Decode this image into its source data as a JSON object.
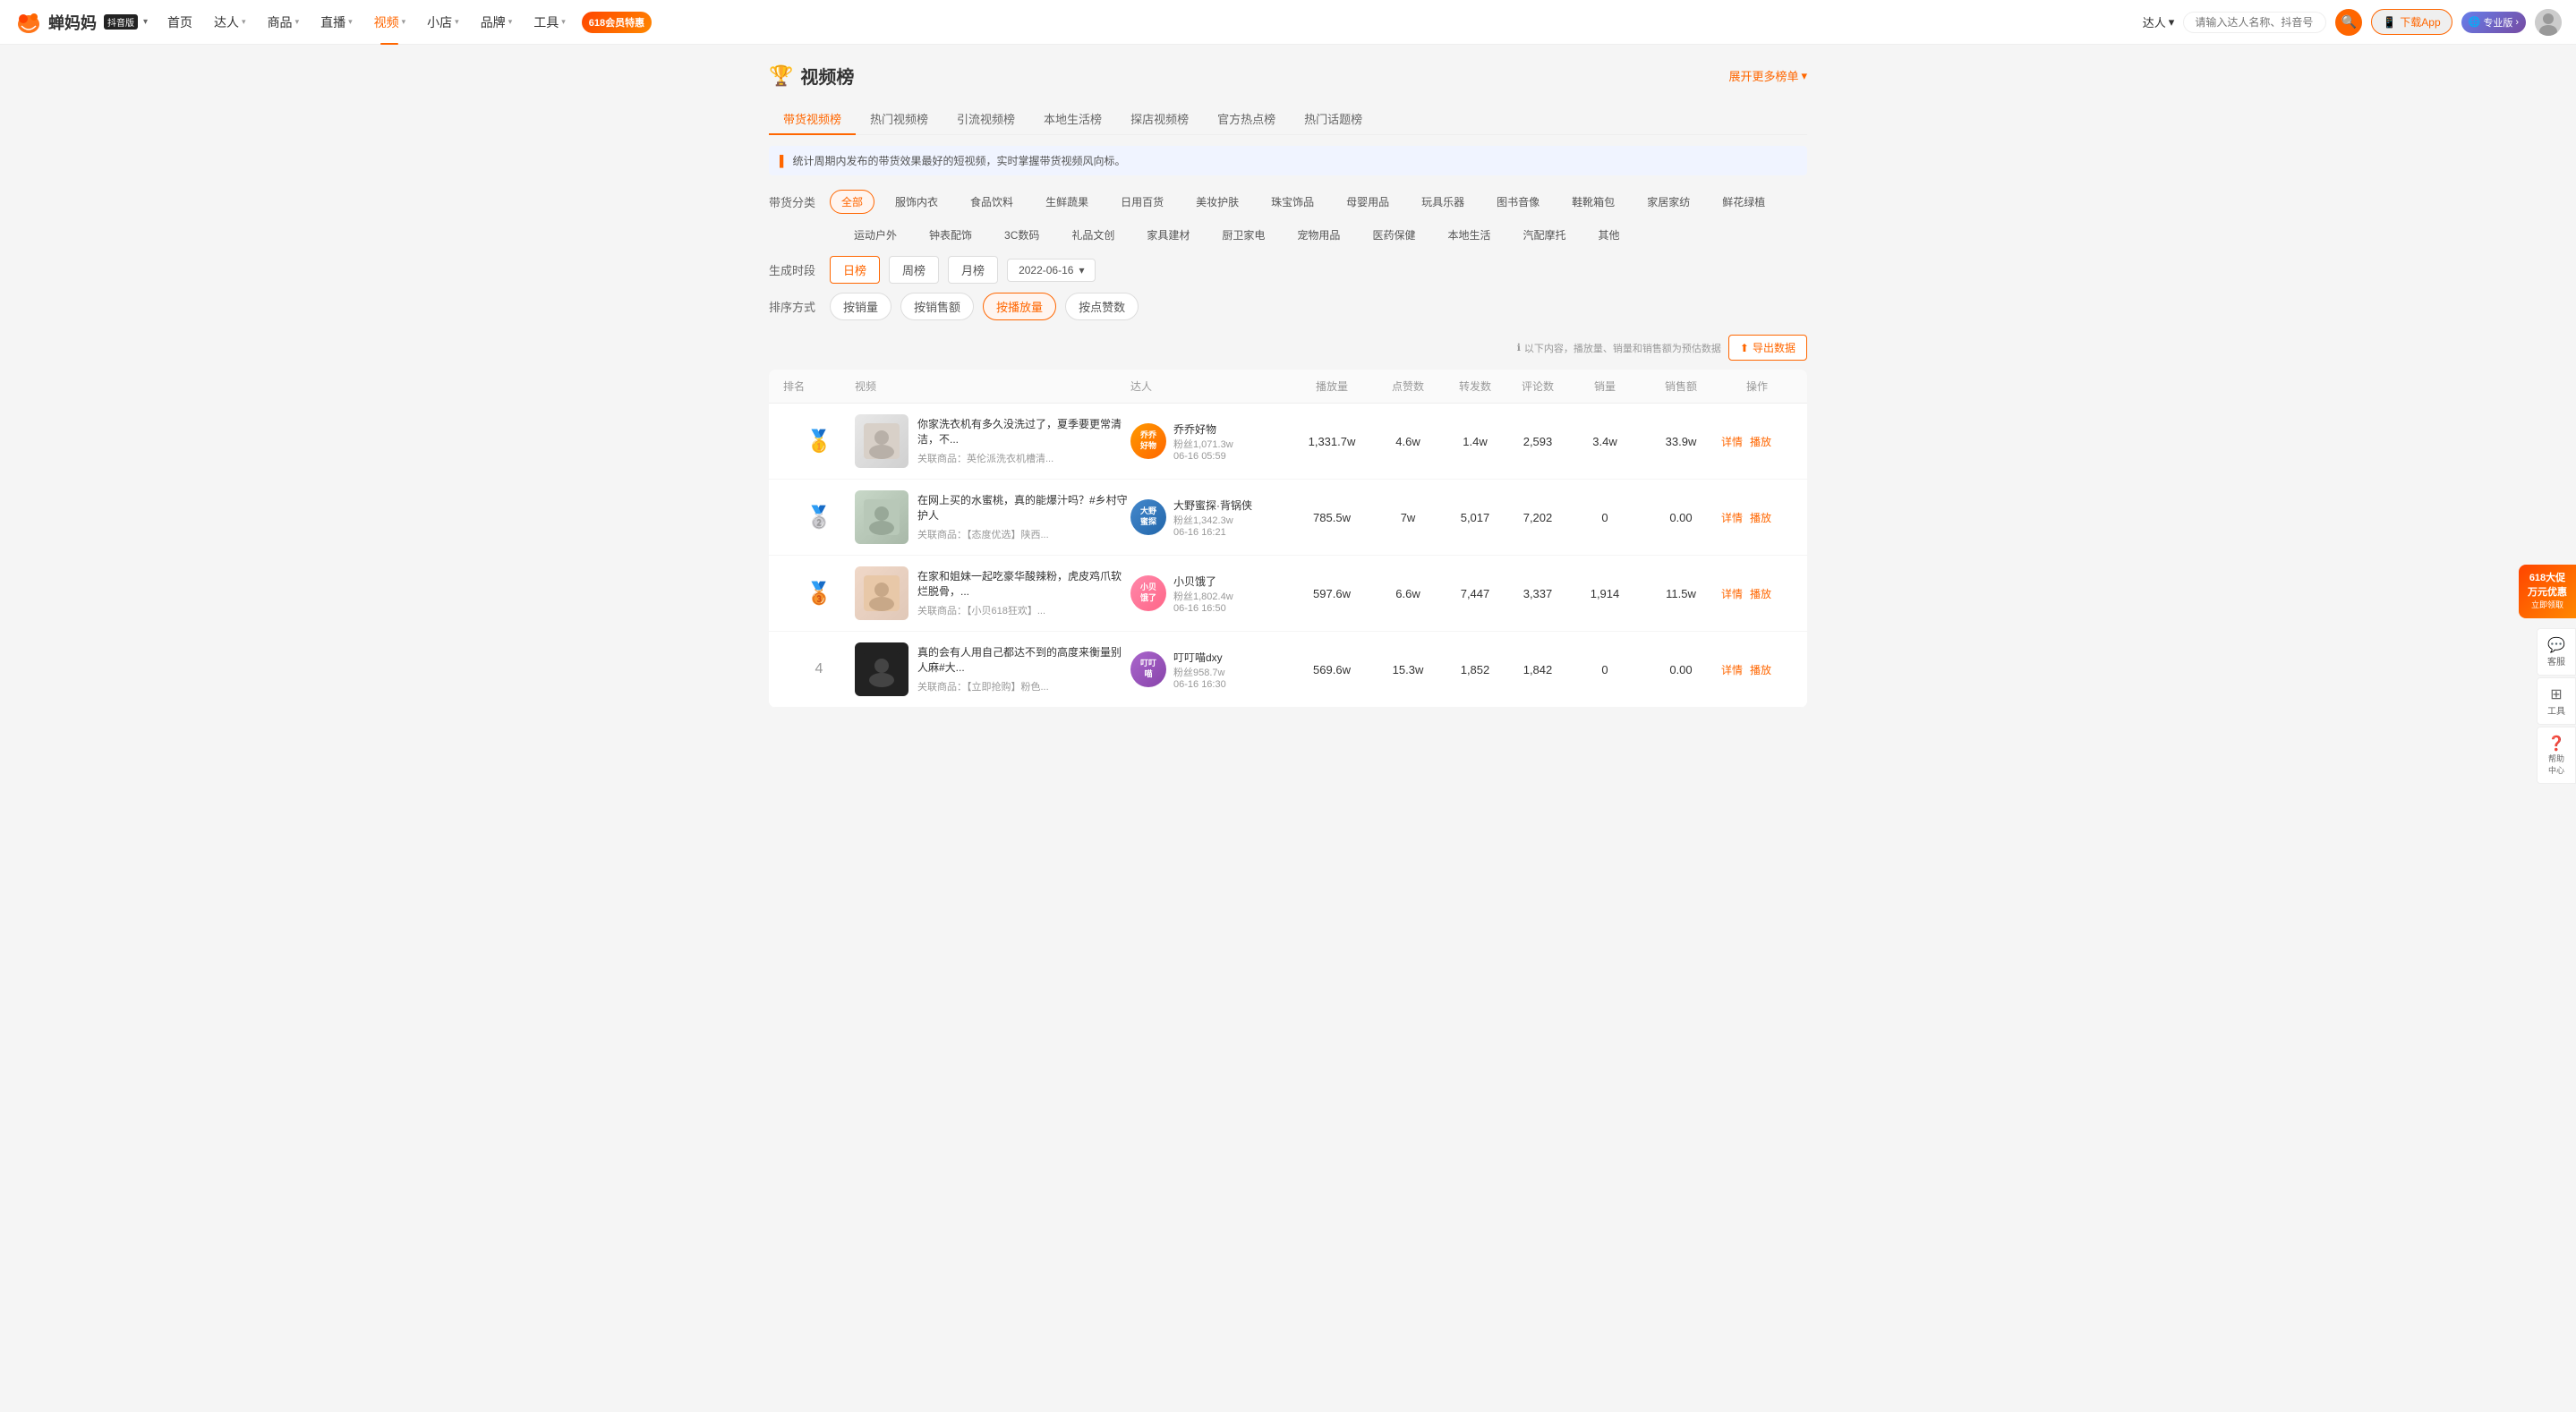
{
  "logo": {
    "text": "蝉妈妈",
    "badge": "抖音版"
  },
  "nav": {
    "chevron": "▾",
    "items": [
      {
        "label": "首页",
        "hasDropdown": false
      },
      {
        "label": "达人",
        "hasDropdown": true
      },
      {
        "label": "商品",
        "hasDropdown": true
      },
      {
        "label": "直播",
        "hasDropdown": true
      },
      {
        "label": "视频",
        "hasDropdown": true,
        "active": true
      },
      {
        "label": "小店",
        "hasDropdown": true
      },
      {
        "label": "品牌",
        "hasDropdown": true
      },
      {
        "label": "工具",
        "hasDropdown": true
      }
    ],
    "promo618": "618\n会员特惠",
    "right": {
      "talent_label": "达人",
      "search_placeholder": "请输入达人名称、抖音号",
      "search_icon": "🔍",
      "download_label": "下载App",
      "pro_label": "专业版",
      "pro_icon": "🌐"
    }
  },
  "page": {
    "title": "视频榜",
    "trophy_icon": "🏆",
    "expand_label": "展开更多榜单",
    "expand_icon": "▾"
  },
  "tabs": [
    {
      "label": "带货视频榜",
      "active": true
    },
    {
      "label": "热门视频榜",
      "active": false
    },
    {
      "label": "引流视频榜",
      "active": false
    },
    {
      "label": "本地生活榜",
      "active": false
    },
    {
      "label": "探店视频榜",
      "active": false
    },
    {
      "label": "官方热点榜",
      "active": false
    },
    {
      "label": "热门话题榜",
      "active": false
    }
  ],
  "info_bar": "统计周期内发布的带货效果最好的短视频，实时掌握带货视频风向标。",
  "filters": {
    "label": "带货分类",
    "row1": [
      {
        "label": "全部",
        "active": true
      },
      {
        "label": "服饰内衣",
        "active": false
      },
      {
        "label": "食品饮料",
        "active": false
      },
      {
        "label": "生鲜蔬果",
        "active": false
      },
      {
        "label": "日用百货",
        "active": false
      },
      {
        "label": "美妆护肤",
        "active": false
      },
      {
        "label": "珠宝饰品",
        "active": false
      },
      {
        "label": "母婴用品",
        "active": false
      },
      {
        "label": "玩具乐器",
        "active": false
      },
      {
        "label": "图书音像",
        "active": false
      },
      {
        "label": "鞋靴箱包",
        "active": false
      },
      {
        "label": "家居家纺",
        "active": false
      },
      {
        "label": "鲜花绿植",
        "active": false
      }
    ],
    "row2": [
      {
        "label": "运动户外",
        "active": false
      },
      {
        "label": "钟表配饰",
        "active": false
      },
      {
        "label": "3C数码",
        "active": false
      },
      {
        "label": "礼品文创",
        "active": false
      },
      {
        "label": "家具建材",
        "active": false
      },
      {
        "label": "厨卫家电",
        "active": false
      },
      {
        "label": "宠物用品",
        "active": false
      },
      {
        "label": "医药保健",
        "active": false
      },
      {
        "label": "本地生活",
        "active": false
      },
      {
        "label": "汽配摩托",
        "active": false
      },
      {
        "label": "其他",
        "active": false
      }
    ]
  },
  "period": {
    "label": "生成时段",
    "buttons": [
      {
        "label": "日榜",
        "active": true
      },
      {
        "label": "周榜",
        "active": false
      },
      {
        "label": "月榜",
        "active": false
      }
    ],
    "date": "2022-06-16",
    "date_caret": "▾"
  },
  "sort": {
    "label": "排序方式",
    "buttons": [
      {
        "label": "按销量",
        "active": false
      },
      {
        "label": "按销售额",
        "active": false
      },
      {
        "label": "按播放量",
        "active": true
      },
      {
        "label": "按点赞数",
        "active": false
      }
    ]
  },
  "export": {
    "hint": "以下内容，播放量、销量和销售额为预估数据",
    "hint_icon": "ℹ",
    "button_label": "导出数据",
    "button_icon": "⬆"
  },
  "table": {
    "headers": [
      "排名",
      "视频",
      "达人",
      "播放量",
      "点赞数",
      "转发数",
      "评论数",
      "销量",
      "销售额",
      "操作"
    ],
    "rows": [
      {
        "rank": "gold",
        "rank_label": "🥇",
        "video_title": "你家洗衣机有多久没洗过了，夏季要更常清洁，不...",
        "video_product": "关联商品：英伦派洗衣机槽清...",
        "thumb_class": "thumb-1",
        "talent_name": "乔乔好物",
        "talent_avatar_text": "乔乔\n好物",
        "talent_avatar_class": "av-orange",
        "talent_fans": "粉丝1,071.3w",
        "talent_date": "06-16 05:59",
        "play": "1,331.7w",
        "likes": "4.6w",
        "shares": "1.4w",
        "comments": "2,593",
        "sales": "3.4w",
        "revenue": "33.9w",
        "detail_label": "详情",
        "play_label": "播放"
      },
      {
        "rank": "silver",
        "rank_label": "🥈",
        "video_title": "在网上买的水蜜桃，真的能爆汁吗？#乡村守护人",
        "video_product": "关联商品：【态度优选】陕西...",
        "thumb_class": "thumb-2",
        "talent_name": "大野蜜探·背锅侠",
        "talent_avatar_text": "大野\n蜜探",
        "talent_avatar_class": "av-blue",
        "talent_fans": "粉丝1,342.3w",
        "talent_date": "06-16 16:21",
        "play": "785.5w",
        "likes": "7w",
        "shares": "5,017",
        "comments": "7,202",
        "sales": "0",
        "revenue": "0.00",
        "detail_label": "详情",
        "play_label": "播放"
      },
      {
        "rank": "bronze",
        "rank_label": "🥉",
        "video_title": "在家和姐妹一起吃豪华酸辣粉，虎皮鸡爪软烂脱骨，...",
        "video_product": "关联商品：【小贝618狂欢】...",
        "thumb_class": "thumb-3",
        "talent_name": "小贝饿了",
        "talent_avatar_text": "小贝\n饿了",
        "talent_avatar_class": "av-pink",
        "talent_fans": "粉丝1,802.4w",
        "talent_date": "06-16 16:50",
        "play": "597.6w",
        "likes": "6.6w",
        "shares": "7,447",
        "comments": "3,337",
        "sales": "1,914",
        "revenue": "11.5w",
        "detail_label": "详情",
        "play_label": "播放"
      },
      {
        "rank": "num",
        "rank_label": "4",
        "video_title": "真的会有人用自己都达不到的高度来衡量别人麻#大...",
        "video_product": "关联商品：【立即抢购】粉色...",
        "thumb_class": "thumb-4",
        "talent_name": "叮叮喵dxy",
        "talent_avatar_text": "叮叮\n喵",
        "talent_avatar_class": "av-purple",
        "talent_fans": "粉丝958.7w",
        "talent_date": "06-16 16:30",
        "play": "569.6w",
        "likes": "15.3w",
        "shares": "1,852",
        "comments": "1,842",
        "sales": "0",
        "revenue": "0.00",
        "detail_label": "详情",
        "play_label": "播放"
      }
    ]
  },
  "side": {
    "promo618_line1": "618大促",
    "promo618_line2": "万元优惠",
    "promo618_line3": "立即领取",
    "service_label": "客服",
    "tools_label": "工具",
    "help_label": "帮助\n中心"
  }
}
